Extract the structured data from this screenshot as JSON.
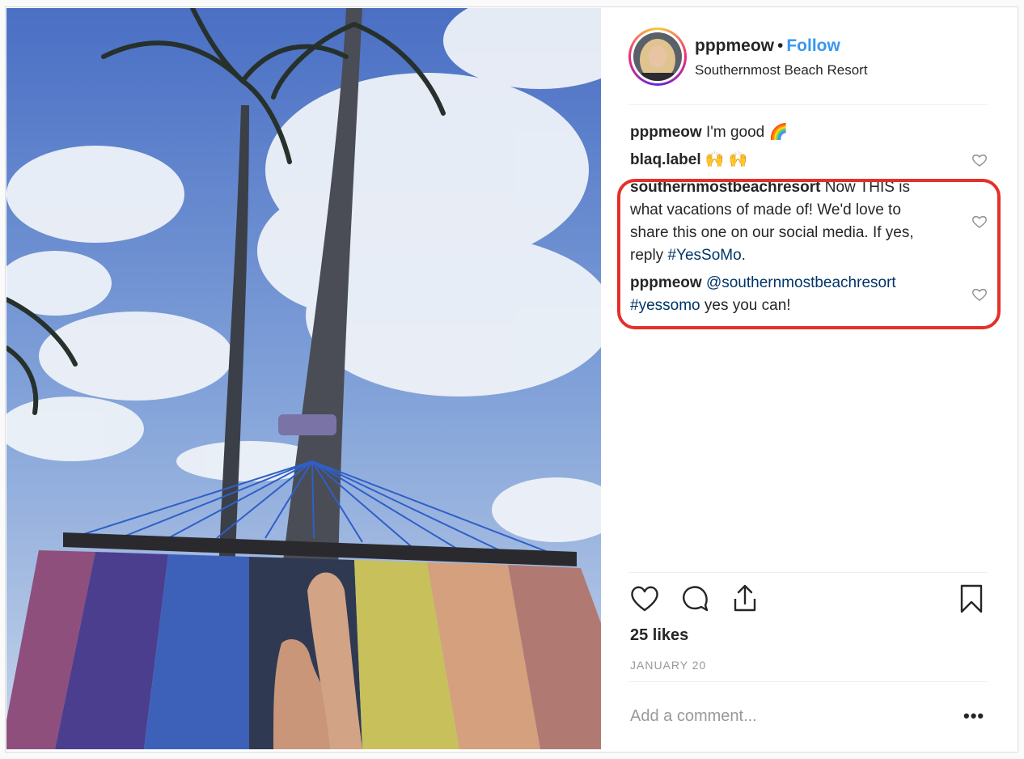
{
  "post": {
    "username": "pppmeow",
    "separator": "•",
    "follow_label": "Follow",
    "location": "Southernmost Beach Resort"
  },
  "comments": [
    {
      "user": "pppmeow",
      "segments": [
        {
          "text": "I'm good 🌈",
          "link": false
        }
      ],
      "liked_icon": false
    },
    {
      "user": "blaq.label",
      "segments": [
        {
          "text": "🙌 🙌",
          "link": false
        }
      ],
      "liked_icon": true
    },
    {
      "user": "southernmostbeachresort",
      "segments": [
        {
          "text": "Now THIS is what vacations of made of! We'd love to share this one on our social media. If yes, reply ",
          "link": false
        },
        {
          "text": "#YesSoMo",
          "link": true
        },
        {
          "text": ".",
          "link": false
        }
      ],
      "liked_icon": true
    },
    {
      "user": "pppmeow",
      "segments": [
        {
          "text": "@southernmostbeachresort",
          "link": true
        },
        {
          "text": " ",
          "link": false
        },
        {
          "text": "#yessomo",
          "link": true
        },
        {
          "text": " yes you can!",
          "link": false
        }
      ],
      "liked_icon": true
    }
  ],
  "actions": {
    "icons": [
      "heart-icon",
      "comment-icon",
      "share-icon",
      "bookmark-icon"
    ]
  },
  "likes_text": "25 likes",
  "date_text": "JANUARY 20",
  "add_comment": {
    "placeholder": "Add a comment...",
    "more_label": "•••"
  },
  "colors": {
    "link": "#003569",
    "follow": "#3897f0",
    "highlight": "#e5302a"
  }
}
